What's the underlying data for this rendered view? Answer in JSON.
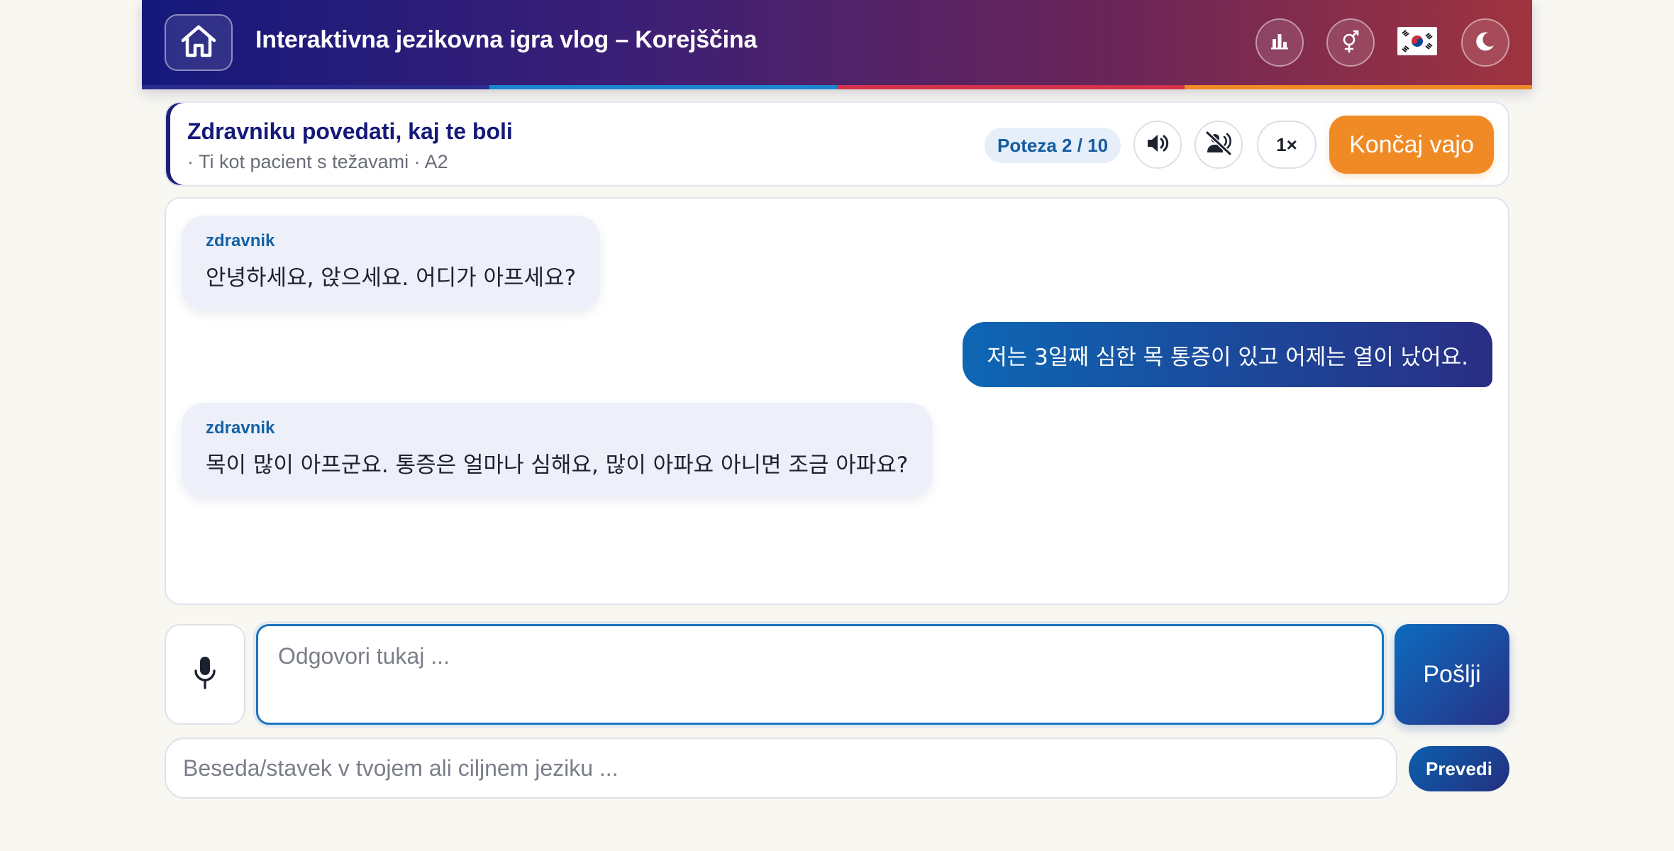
{
  "header": {
    "title": "Interaktivna jezikovna igra vlog – Korejščina",
    "home_icon": "home-icon",
    "stats_icon": "bar-chart-icon",
    "gender_icon": "gender-icon",
    "flag": "🇰🇷",
    "theme_icon": "moon-icon",
    "stripe_colors": [
      "#2a2d8f",
      "#1b86d0",
      "#d3334a",
      "#f08a24"
    ]
  },
  "scenario": {
    "title": "Zdravniku povedati, kaj te boli",
    "subtitle": "· Ti kot pacient s težavami · A2",
    "turn": "Poteza 2 / 10",
    "speed": "1×",
    "end_label": "Končaj vajo"
  },
  "chat": {
    "messages": [
      {
        "role": "partner",
        "speaker": "zdravnik",
        "text": "안녕하세요, 앉으세요. 어디가 아프세요?"
      },
      {
        "role": "user",
        "text": "저는 3일째 심한 목 통증이 있고 어제는 열이 났어요."
      },
      {
        "role": "partner",
        "speaker": "zdravnik",
        "text": "목이 많이 아프군요. 통증은 얼마나 심해요, 많이 아파요 아니면 조금 아파요?"
      }
    ]
  },
  "input": {
    "answer_placeholder": "Odgovori tukaj ...",
    "send_label": "Pošlji",
    "translate_placeholder": "Beseda/stavek v tvojem ali ciljnem jeziku ...",
    "translate_label": "Prevedi"
  },
  "colors": {
    "accent": "#1b74c0",
    "primary_dark": "#14197a",
    "end_button": "#f08a24"
  }
}
